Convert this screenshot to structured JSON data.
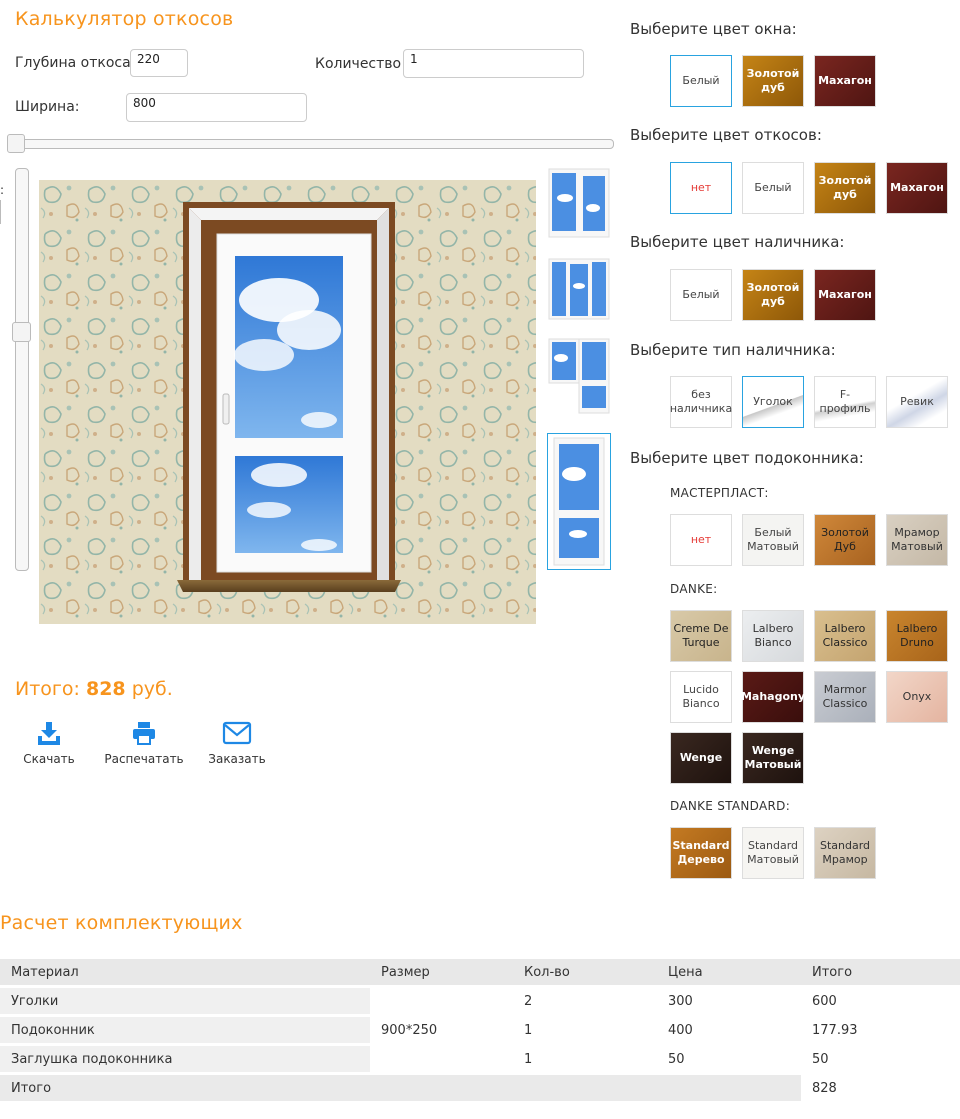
{
  "header": {
    "title": "Калькулятор откосов"
  },
  "form": {
    "depth_label": "Глубина откоса",
    "depth_value": "220",
    "qty_label": "Количество",
    "qty_value": "1",
    "width_label": "Ширина:",
    "width_value": "800",
    "height_label": ":"
  },
  "total": {
    "label": "Итого:",
    "value": "828",
    "unit": "руб."
  },
  "actions": {
    "download": "Скачать",
    "print": "Распечатать",
    "order": "Заказать"
  },
  "window_color": {
    "title": "Выберите цвет окна:",
    "options": [
      "Белый",
      "Золотой дуб",
      "Махагон"
    ],
    "selected": "Белый"
  },
  "slope_color": {
    "title": "Выберите цвет откосов:",
    "options": [
      "нет",
      "Белый",
      "Золотой дуб",
      "Махагон"
    ],
    "selected": "нет"
  },
  "trim_color": {
    "title": "Выберите цвет наличника:",
    "options": [
      "Белый",
      "Золотой дуб",
      "Махагон"
    ]
  },
  "trim_type": {
    "title": "Выберите тип наличника:",
    "options": [
      "без наличника",
      "Уголок",
      "F-профиль",
      "Ревик"
    ],
    "selected": "Уголок"
  },
  "sill_color": {
    "title": "Выберите цвет подоконника:",
    "groups": [
      {
        "name": "МАСТЕРПЛАСТ:",
        "options": [
          "нет",
          "Белый Матовый",
          "Золотой Дуб",
          "Мрамор Матовый"
        ]
      },
      {
        "name": "DANKE:",
        "options": [
          "Creme De Turque",
          "Lalbero Bianco",
          "Lalbero Classico",
          "Lalbero Druno",
          "Lucido Bianco",
          "Mahagony",
          "Marmor Classico",
          "Onyx",
          "Wenge",
          "Wenge Матовый"
        ]
      },
      {
        "name": "DANKE STANDARD:",
        "options": [
          "Standard Дерево",
          "Standard Матовый",
          "Standard Мрамор"
        ]
      }
    ]
  },
  "parts": {
    "title": "Расчет комплектующих",
    "headers": [
      "Материал",
      "Размер",
      "Кол-во",
      "Цена",
      "Итого"
    ],
    "rows": [
      [
        "Уголки",
        "",
        "2",
        "300",
        "600"
      ],
      [
        "Подоконник",
        "900*250",
        "1",
        "400",
        "177.93"
      ],
      [
        "Заглушка подоконника",
        "",
        "1",
        "50",
        "50"
      ]
    ],
    "footer": {
      "label": "Итого",
      "value": "828"
    }
  },
  "colors": {
    "accent": "#f7941d",
    "selected_border": "#29a3e0",
    "icon_blue": "#1e88e5",
    "mahogany": "#6b1f1a",
    "gold_oak": "#b5700f",
    "wenge": "#2a1a14"
  }
}
